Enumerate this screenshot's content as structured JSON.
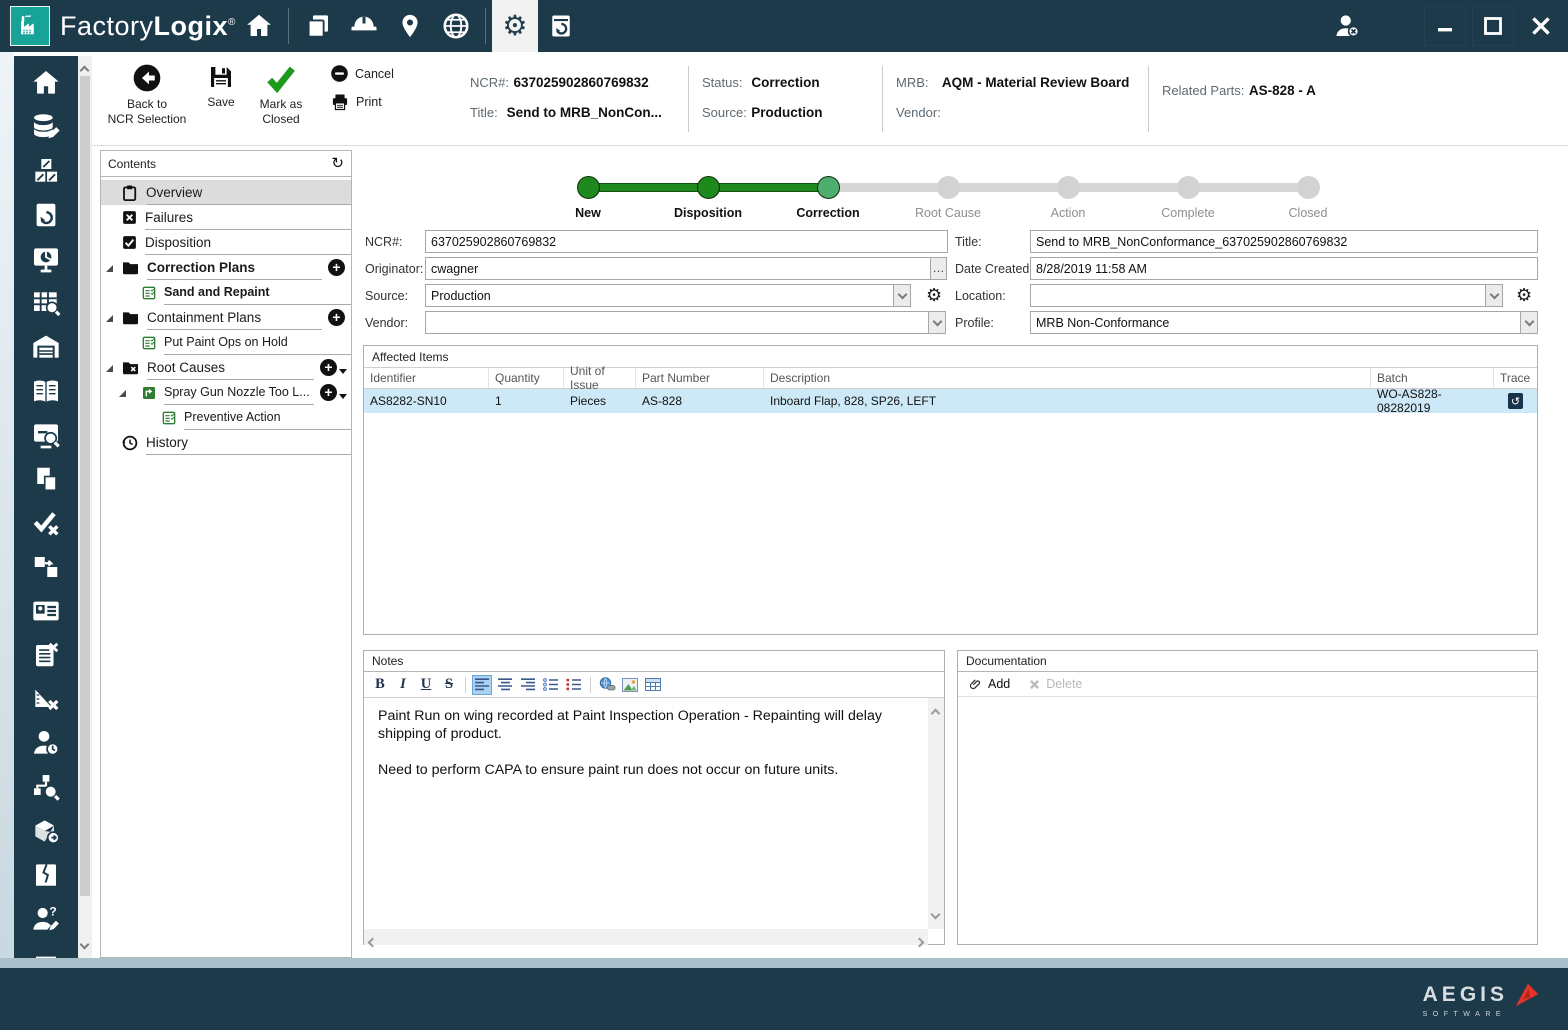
{
  "app": {
    "brand_prefix": "Factory",
    "brand_suffix": "Logix",
    "registered": "®"
  },
  "titlebar": {
    "icons": [
      "factory-logo",
      "home",
      "documents",
      "hard-hat",
      "location-pin",
      "globe",
      "settings-gear",
      "ncr-restore",
      "user-logout",
      "minimize",
      "maximize",
      "close"
    ],
    "selected_icon": "settings-gear"
  },
  "toolbar": {
    "back_line1": "Back to",
    "back_line2": "NCR Selection",
    "save": "Save",
    "mark_line1": "Mark as",
    "mark_line2": "Closed",
    "cancel": "Cancel",
    "print": "Print"
  },
  "ncr_header": {
    "ncr_label": "NCR#:",
    "ncr_value": "637025902860769832",
    "title_label": "Title:",
    "title_value": "Send to MRB_NonCon...",
    "status_label": "Status:",
    "status_value": "Correction",
    "source_label": "Source:",
    "source_value": "Production",
    "mrb_label": "MRB:",
    "mrb_value": "AQM - Material Review Board",
    "vendor_label": "Vendor:",
    "vendor_value": "",
    "related_label": "Related Parts:",
    "related_value": "AS-828 - A"
  },
  "sidebar": {
    "icons": [
      "home",
      "data-editor",
      "materials",
      "document-restore",
      "dashboard",
      "table-search",
      "warehouse",
      "book",
      "monitor-search",
      "document-copy",
      "verify",
      "transfer",
      "id-card",
      "clipboard-remove",
      "measure-remove",
      "person-time",
      "hierarchy-search",
      "package-route",
      "damaged-document",
      "person-question",
      "app-window"
    ]
  },
  "contents": {
    "title": "Contents",
    "items": [
      {
        "label": "Overview"
      },
      {
        "label": "Failures"
      },
      {
        "label": "Disposition"
      },
      {
        "label": "Correction Plans"
      },
      {
        "label": "Sand and Repaint"
      },
      {
        "label": "Containment Plans"
      },
      {
        "label": "Put Paint Ops on Hold"
      },
      {
        "label": "Root Causes"
      },
      {
        "label": "Spray Gun Nozzle Too L..."
      },
      {
        "label": "Preventive Action"
      },
      {
        "label": "History"
      }
    ]
  },
  "stepper": {
    "steps": [
      {
        "label": "New",
        "state": "done"
      },
      {
        "label": "Disposition",
        "state": "done"
      },
      {
        "label": "Correction",
        "state": "current"
      },
      {
        "label": "Root Cause",
        "state": "todo"
      },
      {
        "label": "Action",
        "state": "todo"
      },
      {
        "label": "Complete",
        "state": "todo"
      },
      {
        "label": "Closed",
        "state": "todo"
      }
    ]
  },
  "form": {
    "ncr_label": "NCR#:",
    "ncr_value": "637025902860769832",
    "title_label": "Title:",
    "title_value": "Send to MRB_NonConformance_637025902860769832",
    "originator_label": "Originator:",
    "originator_value": "cwagner",
    "date_label": "Date Created:",
    "date_value": "8/28/2019 11:58 AM",
    "source_label": "Source:",
    "source_value": "Production",
    "location_label": "Location:",
    "location_value": "",
    "vendor_label": "Vendor:",
    "vendor_value": "",
    "profile_label": "Profile:",
    "profile_value": "MRB Non-Conformance"
  },
  "affected_items": {
    "title": "Affected Items",
    "columns": [
      "Identifier",
      "Quantity",
      "Unit of Issue",
      "Part Number",
      "Description",
      "Batch",
      "Trace"
    ],
    "rows": [
      {
        "identifier": "AS8282-SN10",
        "quantity": "1",
        "unit": "Pieces",
        "part": "AS-828",
        "description": "Inboard Flap, 828, SP26, LEFT",
        "batch": "WO-AS828-08282019"
      }
    ]
  },
  "notes": {
    "title": "Notes",
    "bold_label": "B",
    "italic_label": "I",
    "underline_label": "U",
    "strike_label": "S",
    "toolbar_icons": [
      "bold",
      "italic",
      "underline",
      "strikethrough",
      "align-left",
      "align-center",
      "align-right",
      "bullet-list",
      "numbered-list",
      "insert-link",
      "insert-image",
      "insert-table"
    ],
    "active_tool": "align-left",
    "p1": "Paint Run on wing recorded at Paint Inspection Operation - Repainting will delay shipping of product.",
    "p2": "Need to perform CAPA to ensure paint run does not occur on future units."
  },
  "documentation": {
    "title": "Documentation",
    "add": "Add",
    "delete": "Delete"
  },
  "footer": {
    "brand": "AEGIS",
    "sub": "SOFTWARE"
  },
  "colors": {
    "titlebar_navy": "#1d3a4b",
    "logo_teal": "#17a398",
    "step_done_green": "#1e8a1e",
    "step_current_green": "#4fae6d",
    "selected_row_blue": "#cde8f6",
    "aegis_red": "#e63329"
  }
}
